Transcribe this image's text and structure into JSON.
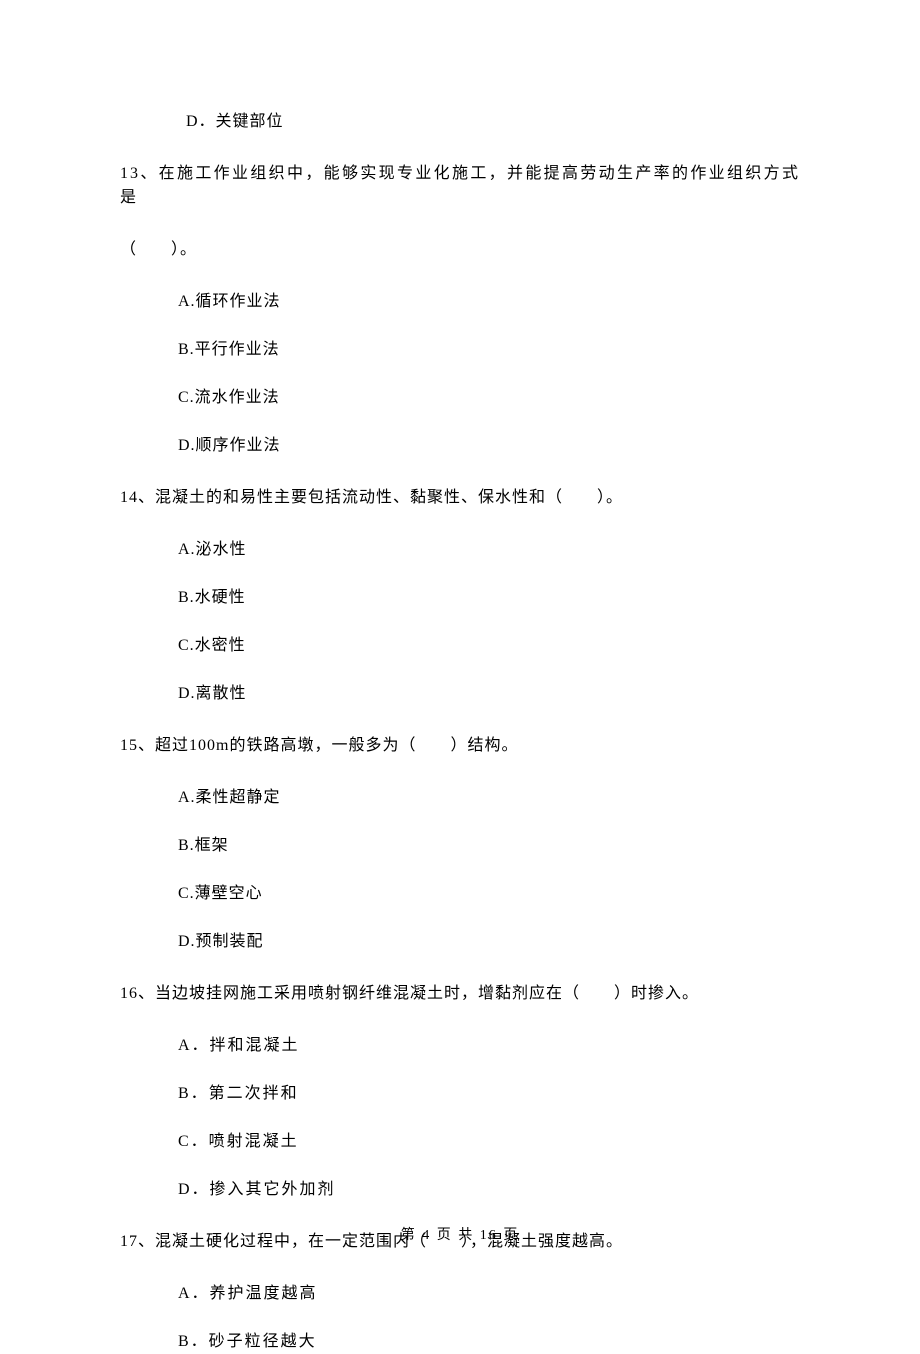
{
  "orphan_option": "D．关键部位",
  "questions": [
    {
      "stem_wide": "13、在施工作业组织中，能够实现专业化施工，并能提高劳动生产率的作业组织方式是",
      "stem_cont": "（　　）。",
      "options": [
        "A.循环作业法",
        "B.平行作业法",
        "C.流水作业法",
        "D.顺序作业法"
      ]
    },
    {
      "stem": "14、混凝土的和易性主要包括流动性、黏聚性、保水性和（　　）。",
      "options": [
        "A.泌水性",
        "B.水硬性",
        "C.水密性",
        "D.离散性"
      ]
    },
    {
      "stem": "15、超过100m的铁路高墩，一般多为（　　）结构。",
      "options": [
        "A.柔性超静定",
        "B.框架",
        "C.薄壁空心",
        "D.预制装配"
      ]
    },
    {
      "stem": "16、当边坡挂网施工采用喷射钢纤维混凝土时，增黏剂应在（　　）时掺入。",
      "options": [
        "A．拌和混凝土",
        "B．第二次拌和",
        "C．喷射混凝土",
        "D．掺入其它外加剂"
      ],
      "options_wide": true
    },
    {
      "stem": "17、混凝土硬化过程中，在一定范围内（　　），混凝土强度越高。",
      "options": [
        "A．养护温度越高",
        "B．砂子粒径越大"
      ],
      "options_wide": true
    }
  ],
  "footer": "第 4 页 共 16 页"
}
